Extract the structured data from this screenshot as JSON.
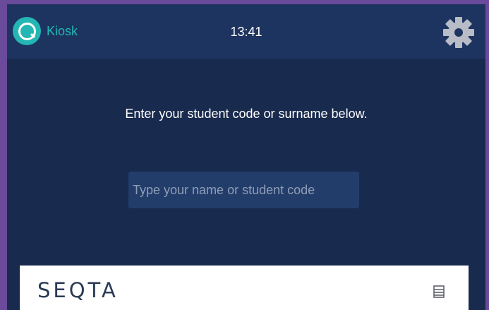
{
  "header": {
    "app_name": "Kiosk",
    "time": "13:41",
    "logo_icon": "q-logo-icon",
    "settings_icon": "gear-icon"
  },
  "main": {
    "prompt": "Enter your student code or surname below.",
    "search_placeholder": "Type your name or student code",
    "search_value": ""
  },
  "footer": {
    "logo_text": "SEQTA",
    "menu_icon": "hamburger-menu-icon"
  },
  "colors": {
    "frame": "#6a4a9a",
    "background": "#182a4d",
    "header": "#1e3460",
    "accent": "#23b6b4",
    "input_bg": "#233d6b"
  }
}
